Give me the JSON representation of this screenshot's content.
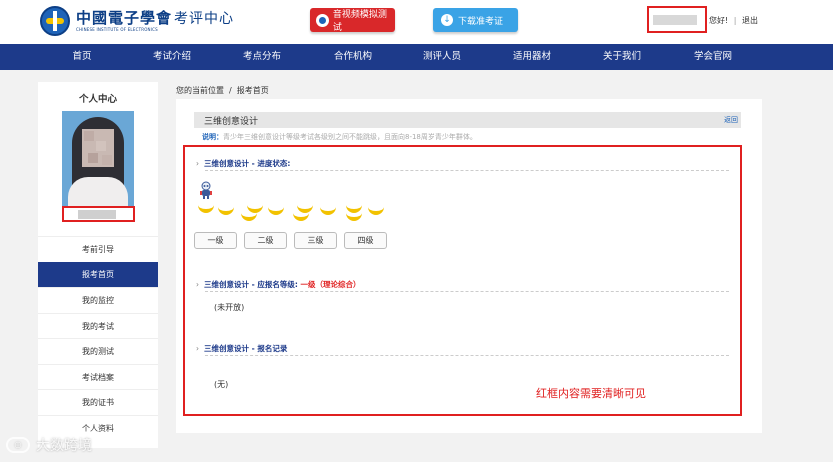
{
  "header": {
    "logo_cn": "中國電子學會",
    "logo_suffix": "考评中心",
    "logo_en": "CHINESE INSTITUTE OF ELECTRONICS",
    "audio_test_label": "音视频模拟测试",
    "download_ticket_label": "下载准考证",
    "greeting": "您好!",
    "logout": "退出"
  },
  "nav": {
    "items": [
      "首页",
      "考试介绍",
      "考点分布",
      "合作机构",
      "测评人员",
      "适用器材",
      "关于我们",
      "学会官网"
    ]
  },
  "sidebar": {
    "title": "个人中心",
    "items": [
      "考前引导",
      "报考首页",
      "我的监控",
      "我的考试",
      "我的测试",
      "考试档案",
      "我的证书",
      "个人资料"
    ],
    "active_index": 1
  },
  "breadcrumb": {
    "current": "您的当前位置",
    "sep": "/",
    "page": "报考首页"
  },
  "main": {
    "section_title": "三维创意设计",
    "back_label": "返回",
    "note_label": "说明：",
    "note_text": "青少年三维创意设计等级考试各级别之间不能跳级，且面向8-18周岁青少年群体。",
    "progress_title": "三维创意设计 - 进度状态:",
    "levels": [
      "一级",
      "二级",
      "三级",
      "四级"
    ],
    "apply_title": "三维创意设计 - 应报名等级:",
    "apply_value": "一级（理论综合）",
    "apply_status": "(未开放)",
    "record_title": "三维创意设计 - 报名记录",
    "record_status": "(无)"
  },
  "annotation": "红框内容需要清晰可见",
  "watermark": "大数跨境",
  "colors": {
    "nav_blue": "#1d3a8a",
    "annotation_red": "#e02020",
    "audio_button": "#d9282a",
    "ticket_button": "#3aa3e6"
  }
}
